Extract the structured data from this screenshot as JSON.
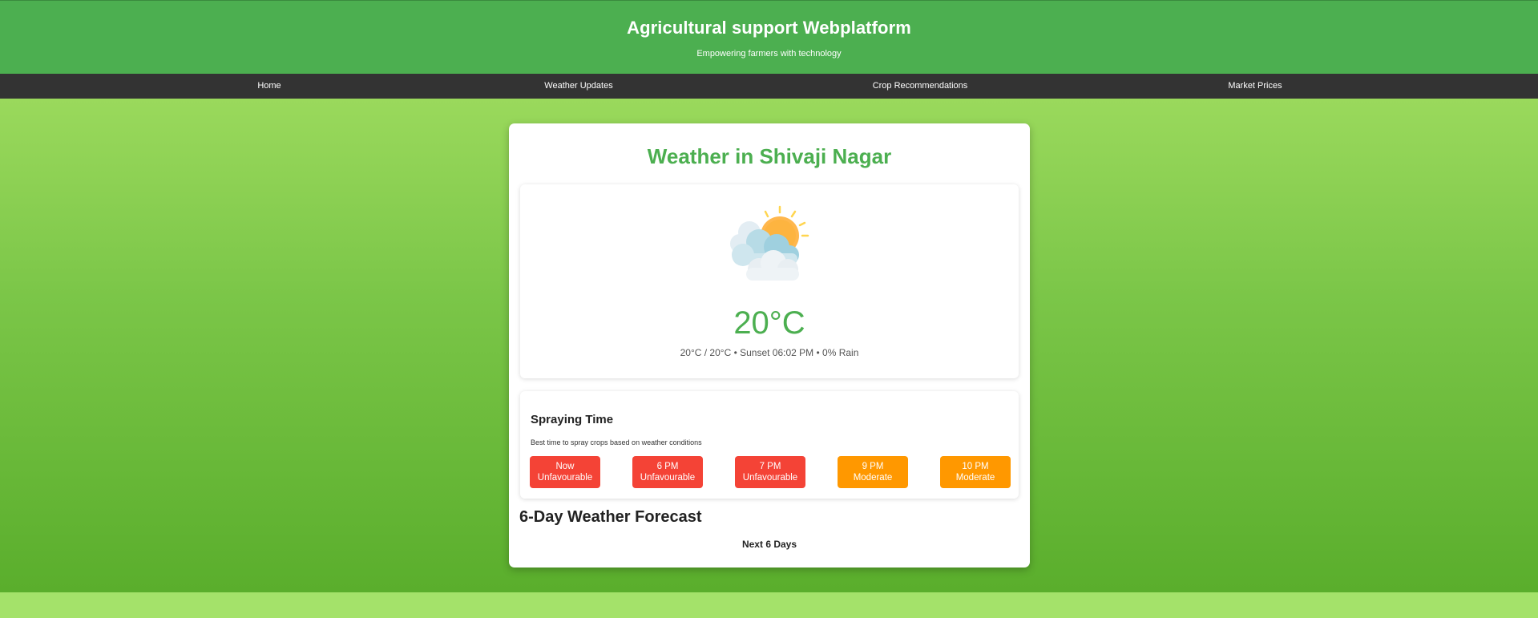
{
  "header": {
    "title": "Agricultural support Webplatform",
    "subtitle": "Empowering farmers with technology"
  },
  "nav": {
    "items": [
      {
        "label": "Home"
      },
      {
        "label": "Weather Updates"
      },
      {
        "label": "Crop Recommendations"
      },
      {
        "label": "Market Prices"
      }
    ]
  },
  "weather": {
    "title": "Weather in Shivaji Nagar",
    "icon": "partly-cloudy-sun-icon",
    "temperature": "20°C",
    "details": "20°C / 20°C • Sunset 06:02 PM • 0% Rain"
  },
  "spraying": {
    "title": "Spraying Time",
    "description": "Best time to spray crops based on weather conditions",
    "slots": [
      {
        "time": "Now",
        "status": "Unfavourable",
        "color": "#f44336"
      },
      {
        "time": "6 PM",
        "status": "Unfavourable",
        "color": "#f44336"
      },
      {
        "time": "7 PM",
        "status": "Unfavourable",
        "color": "#f44336"
      },
      {
        "time": "9 PM",
        "status": "Moderate",
        "color": "#ff9800"
      },
      {
        "time": "10 PM",
        "status": "Moderate",
        "color": "#ff9800"
      }
    ]
  },
  "forecast": {
    "title": "6-Day Weather Forecast",
    "subtitle": "Next 6 Days"
  },
  "colors": {
    "header_green": "#4caf50",
    "nav_dark": "#333333",
    "unfavourable": "#f44336",
    "moderate": "#ff9800"
  }
}
